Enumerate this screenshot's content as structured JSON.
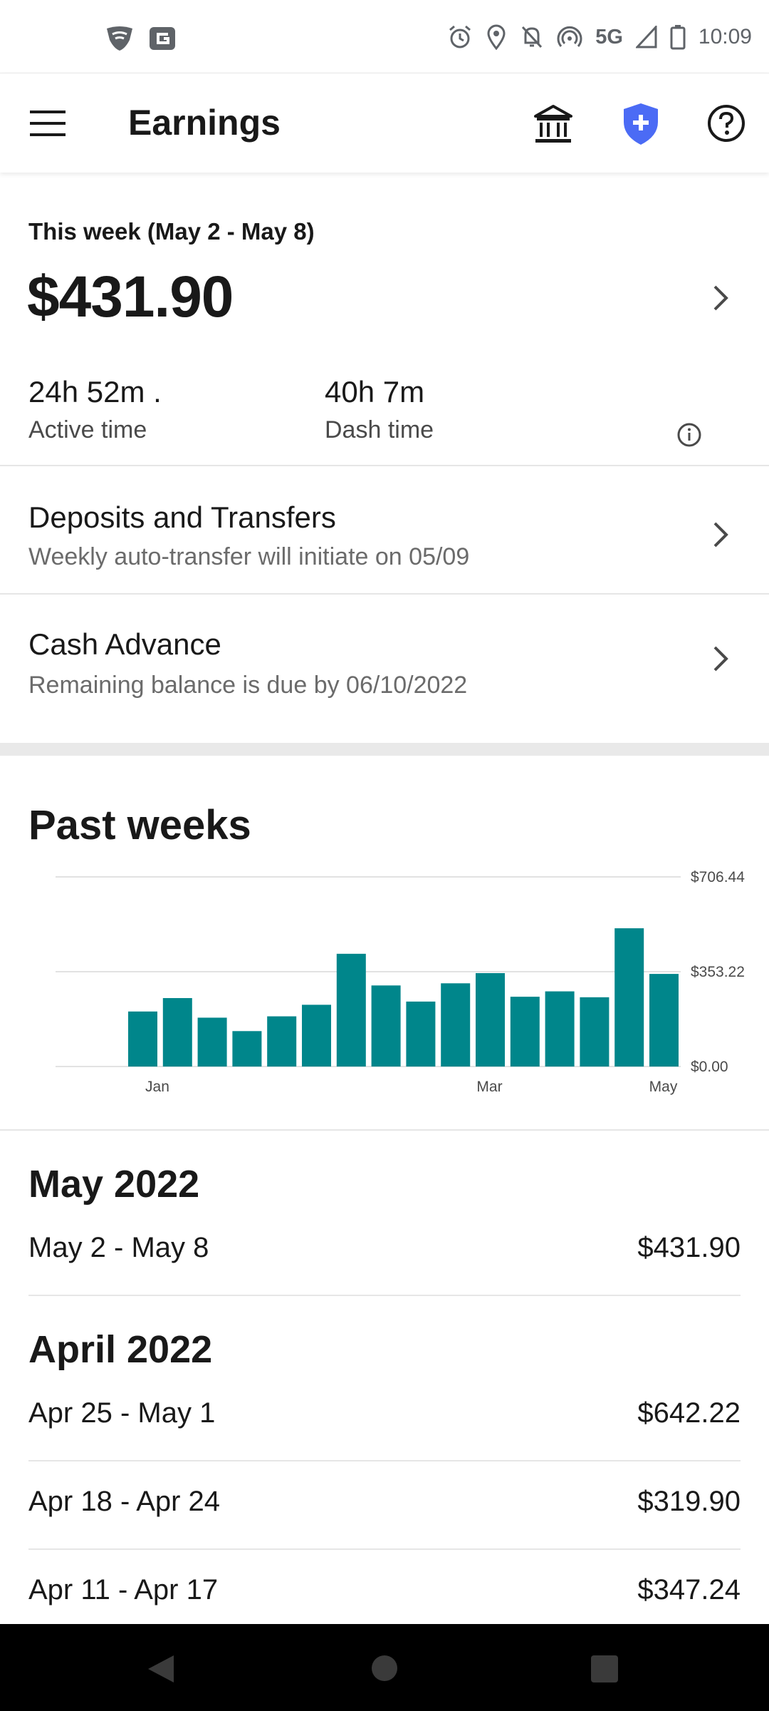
{
  "status_bar": {
    "time": "10:09",
    "network": "5G",
    "icons": [
      "shield-wifi-icon",
      "g-icon",
      "alarm-icon",
      "location-icon",
      "notifications-off-icon",
      "hotspot-icon",
      "signal-icon",
      "battery-icon"
    ]
  },
  "app_bar": {
    "title": "Earnings",
    "icons": [
      "menu-icon",
      "bank-icon",
      "shield-plus-icon",
      "help-icon"
    ],
    "shield_color": "#4b6bf5"
  },
  "this_week": {
    "label": "This week (May 2 - May 8)",
    "amount": "$431.90",
    "active_time_value": "24h 52m .",
    "active_time_label": "Active time",
    "dash_time_value": "40h 7m",
    "dash_time_label": "Dash time"
  },
  "deposits": {
    "title": "Deposits and Transfers",
    "subtitle": "Weekly auto-transfer will initiate on 05/09"
  },
  "cash_advance": {
    "title": "Cash Advance",
    "subtitle": "Remaining balance is due by 06/10/2022"
  },
  "past_weeks": {
    "title": "Past weeks"
  },
  "chart_data": {
    "type": "bar",
    "color": "#00868b",
    "values": [
      205,
      255,
      182,
      132,
      187,
      230,
      420,
      302,
      242,
      310,
      348,
      260,
      280,
      258,
      515,
      345
    ],
    "x_tick_labels": [
      {
        "label": "Jan",
        "index": 0.84
      },
      {
        "label": "Mar",
        "index": 10.4
      },
      {
        "label": "May",
        "index": 15.4
      }
    ],
    "y_tick_labels": [
      "$706.44",
      "$353.22",
      "$0.00"
    ],
    "ylim": [
      0,
      706.44
    ],
    "grid": true
  },
  "months": [
    {
      "name": "May 2022",
      "weeks": [
        {
          "range": "May 2 - May 8",
          "amount": "$431.90"
        }
      ]
    },
    {
      "name": "April 2022",
      "weeks": [
        {
          "range": "Apr 25 - May 1",
          "amount": "$642.22"
        },
        {
          "range": "Apr 18 - Apr 24",
          "amount": "$319.90"
        },
        {
          "range": "Apr 11 - Apr 17",
          "amount": "$347.24"
        }
      ]
    }
  ]
}
